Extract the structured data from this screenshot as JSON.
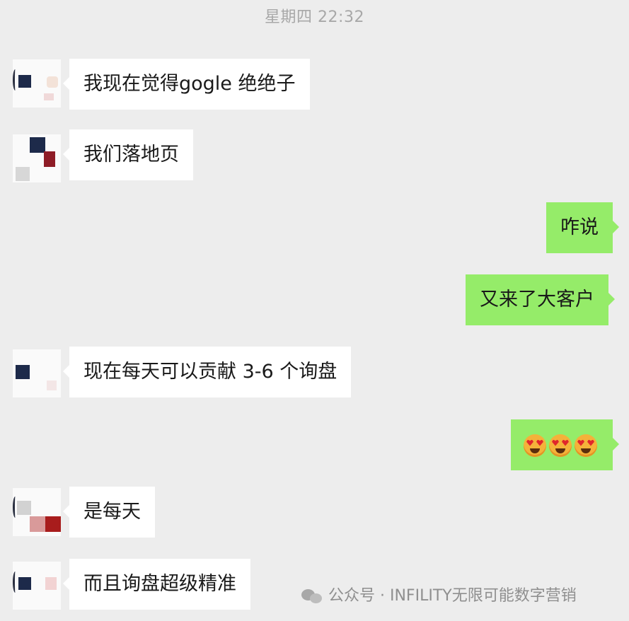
{
  "chat": {
    "timestamp": "星期四 22:32",
    "messages": [
      {
        "side": "in",
        "text": "我现在觉得gogle 绝绝子"
      },
      {
        "side": "in",
        "text": "我们落地页"
      },
      {
        "side": "out",
        "text": "咋说"
      },
      {
        "side": "out",
        "text": "又来了大客户"
      },
      {
        "side": "in",
        "text": "现在每天可以贡献 3-6 个询盘"
      },
      {
        "side": "out",
        "emojis": [
          "heart-eyes-emoji",
          "heart-eyes-emoji",
          "heart-eyes-emoji"
        ]
      },
      {
        "side": "in",
        "text": "是每天"
      },
      {
        "side": "in",
        "text": "而且询盘超级精准"
      }
    ]
  },
  "watermark": {
    "text": "公众号 · INFILITY无限可能数字营销",
    "icon": "wechat-icon"
  },
  "colors": {
    "background": "#ededed",
    "incoming_bubble": "#ffffff",
    "outgoing_bubble": "#95ec69",
    "text": "#191919",
    "timestamp": "#a8a8a8",
    "avatar_navy": "#1d2a4a",
    "avatar_red": "#8e1c26"
  }
}
